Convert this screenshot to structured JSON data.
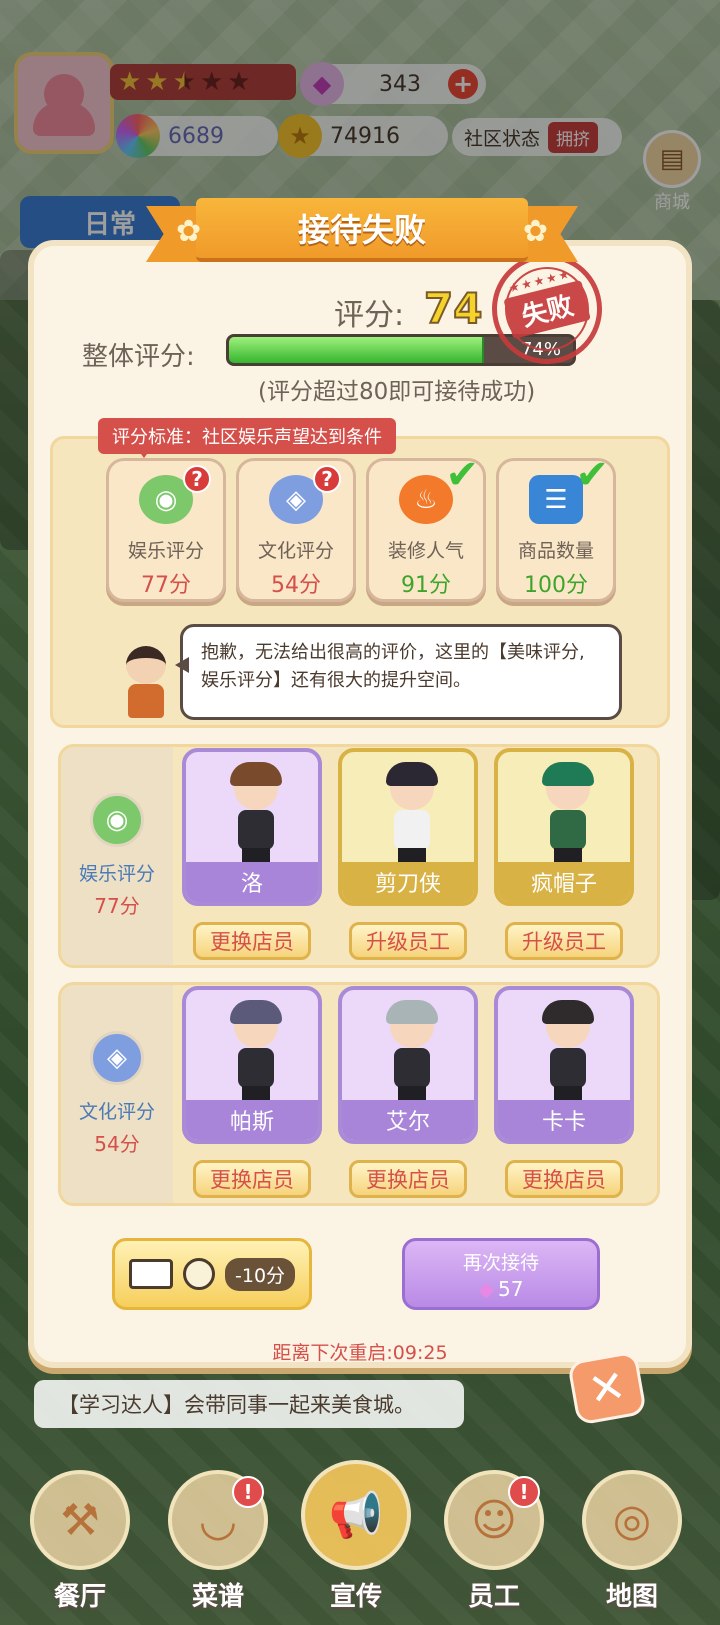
{
  "hud": {
    "stars_filled": 2.5,
    "stars_total": 5,
    "gems": "343",
    "rainbow": "6689",
    "coins": "74916",
    "community_status_label": "社区状态",
    "community_status_value": "拥挤",
    "shop_label": "商城",
    "daily_label": "日常"
  },
  "dialog": {
    "title": "接待失败",
    "score_label": "评分:",
    "score_value": "74",
    "overall_label": "整体评分:",
    "progress_fraction": 0.74,
    "progress_text": "74%",
    "hint": "(评分超过80即可接待成功)",
    "stamp_text": "失败",
    "criteria_tip": "评分标准：社区娱乐声望达到条件",
    "criteria": [
      {
        "name": "娱乐评分",
        "points": "77分",
        "status": "question",
        "icon": "gamepad-icon",
        "color": "#7cc86a"
      },
      {
        "name": "文化评分",
        "points": "54分",
        "status": "question",
        "icon": "graduation-cap-icon",
        "color": "#7f9ee0"
      },
      {
        "name": "装修人气",
        "points": "91分",
        "status": "ok",
        "icon": "fire-icon",
        "color": "#f27a2a"
      },
      {
        "name": "商品数量",
        "points": "100分",
        "status": "ok",
        "icon": "clipboard-icon",
        "color": "#3a86d6"
      }
    ],
    "speech": "抱歉，无法给出很高的评价，这里的【美味评分,娱乐评分】还有很大的提升空间。",
    "groups": [
      {
        "name": "娱乐评分",
        "points": "77分",
        "staff": [
          {
            "name": "洛",
            "action": "更换店员",
            "tier": "purple"
          },
          {
            "name": "剪刀侠",
            "action": "升级员工",
            "tier": "gold"
          },
          {
            "name": "疯帽子",
            "action": "升级员工",
            "tier": "gold"
          }
        ]
      },
      {
        "name": "文化评分",
        "points": "54分",
        "staff": [
          {
            "name": "帕斯",
            "action": "更换店员",
            "tier": "purple"
          },
          {
            "name": "艾尔",
            "action": "更换店员",
            "tier": "purple"
          },
          {
            "name": "卡卡",
            "action": "更换店员",
            "tier": "purple"
          }
        ]
      }
    ],
    "ad_time": "-10分",
    "retry_label": "再次接待",
    "retry_cost": "57",
    "countdown": "距离下次重启:09:25"
  },
  "ticker": "【学习达人】会带同事一起来美食城。",
  "nav": [
    {
      "label": "餐厅",
      "icon": "restaurant-icon",
      "alert": false
    },
    {
      "label": "菜谱",
      "icon": "recipe-bowl-icon",
      "alert": true
    },
    {
      "label": "宣传",
      "icon": "megaphone-icon",
      "alert": false
    },
    {
      "label": "员工",
      "icon": "chef-icon",
      "alert": true
    },
    {
      "label": "地图",
      "icon": "map-icon",
      "alert": false
    }
  ]
}
